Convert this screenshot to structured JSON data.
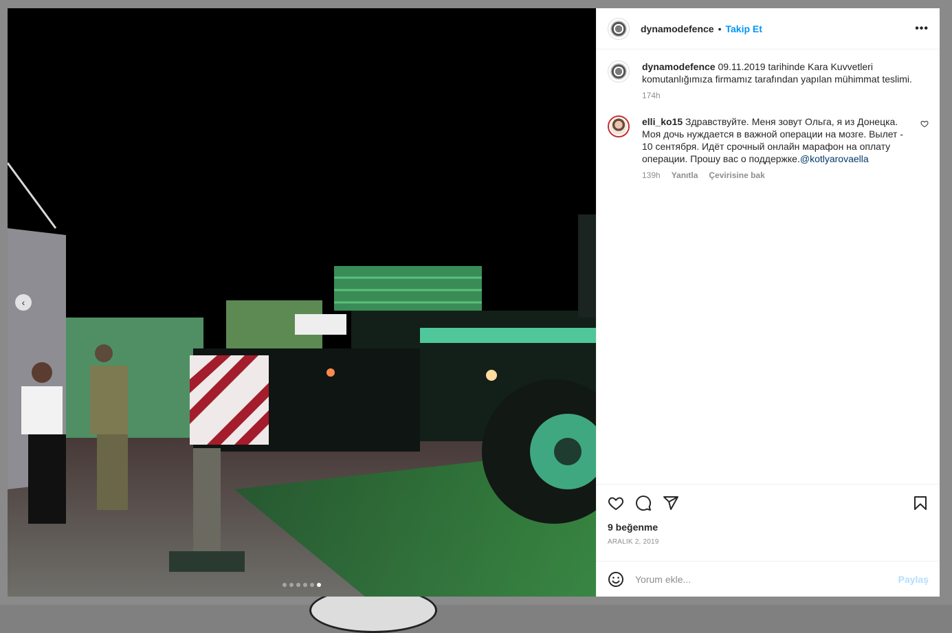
{
  "post": {
    "username": "dynamodefence",
    "separator": "•",
    "follow_label": "Takip Et",
    "more_label": "•••",
    "caption": {
      "username": "dynamodefence",
      "text": "09.11.2019 tarihinde Kara Kuvvetleri komutanlığımıza firmamız tarafından yapılan mühimmat teslimi.",
      "time": "174h"
    },
    "comments": [
      {
        "username": "elli_ko15",
        "text": "Здравствуйте. Меня зовут Ольга, я из Донецка. Моя дочь нуждается в важной операции на мозге. Вылет - 10 сентября. Идёт срочный онлайн марафон на оплату операции. Прошу вас о поддержке.",
        "mention": "@kotlyarovaella",
        "time": "139h",
        "reply_label": "Yanıtla",
        "translate_label": "Çevirisine bak"
      }
    ],
    "likes": "9 beğenme",
    "date": "ARALIK 2, 2019",
    "comment_placeholder": "Yorum ekle...",
    "share_label": "Paylaş",
    "carousel": {
      "count": 6,
      "active_index": 5
    }
  },
  "icons": {
    "prev": "chevron-left-icon",
    "like": "heart-icon",
    "comment": "speech-bubble-icon",
    "share": "paper-plane-icon",
    "save": "bookmark-icon",
    "emoji": "smiley-icon"
  },
  "colors": {
    "accent": "#0095f6",
    "mention": "#00376b",
    "muted": "#8e8e8e",
    "share_disabled": "#b2dffc"
  }
}
